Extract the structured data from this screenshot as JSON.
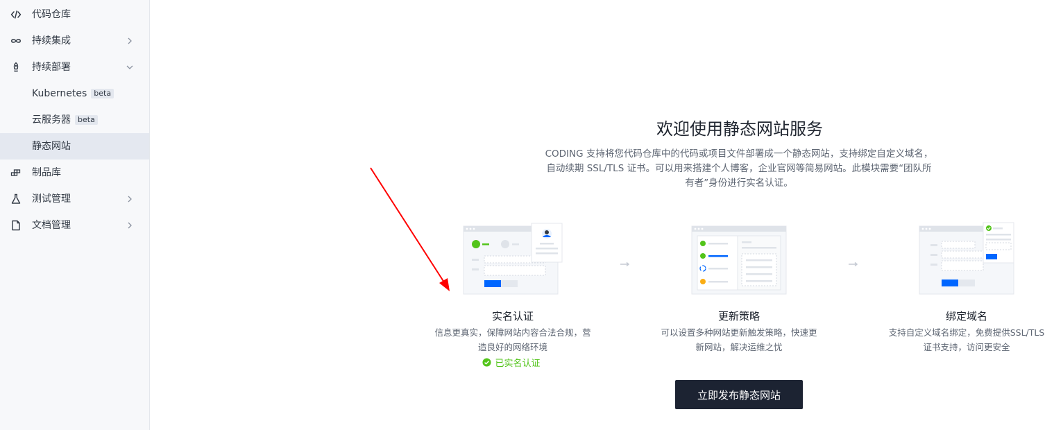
{
  "sidebar": {
    "items": [
      {
        "label": "代码仓库",
        "icon": "code-icon"
      },
      {
        "label": "持续集成",
        "icon": "infinity-icon"
      },
      {
        "label": "持续部署",
        "icon": "rocket-icon"
      },
      {
        "label": "Kubernetes",
        "badge": "beta"
      },
      {
        "label": "云服务器",
        "badge": "beta"
      },
      {
        "label": "静态网站"
      },
      {
        "label": "制品库",
        "icon": "artifact-icon"
      },
      {
        "label": "测试管理",
        "icon": "flask-icon"
      },
      {
        "label": "文档管理",
        "icon": "document-icon"
      }
    ]
  },
  "main": {
    "title": "欢迎使用静态网站服务",
    "description": "CODING 支持将您代码仓库中的代码或项目文件部署成一个静态网站，支持绑定自定义域名，自动续期 SSL/TLS 证书。可以用来搭建个人博客，企业官网等简易网站。此模块需要“团队所有者”身份进行实名认证。",
    "steps": [
      {
        "title": "实名认证",
        "desc": "信息更真实，保障网站内容合法合规，营造良好的网络环境",
        "status": "已实名认证"
      },
      {
        "title": "更新策略",
        "desc": "可以设置多种网站更新触发策略，快速更新网站，解决运维之忧"
      },
      {
        "title": "绑定域名",
        "desc": "支持自定义域名绑定，免费提供SSL/TLS证书支持，访问更安全"
      }
    ],
    "publish_button": "立即发布静态网站"
  },
  "colors": {
    "accent": "#0066ff",
    "success": "#52c41a",
    "button_dark": "#1c2332",
    "annotation": "#ff0000"
  }
}
